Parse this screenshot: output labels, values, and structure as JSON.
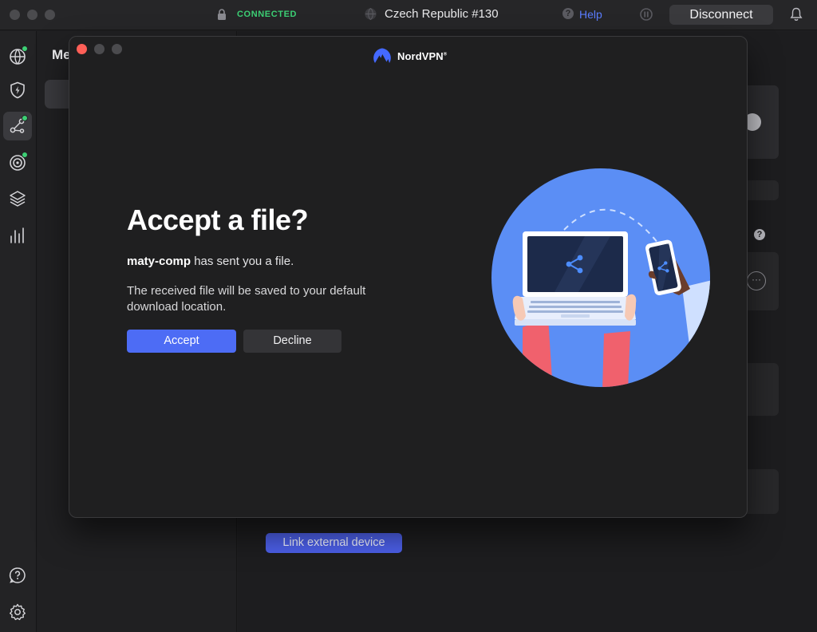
{
  "titlebar": {
    "status": "CONNECTED",
    "server": "Czech Republic #130",
    "help_label": "Help",
    "disconnect_label": "Disconnect"
  },
  "sidebar": {
    "items": [
      {
        "icon": "globe-icon",
        "status_dot": true
      },
      {
        "icon": "shield-bolt-icon",
        "status_dot": false
      },
      {
        "icon": "meshnet-icon",
        "status_dot": true,
        "active": true
      },
      {
        "icon": "target-icon",
        "status_dot": true
      },
      {
        "icon": "layers-icon",
        "status_dot": false
      },
      {
        "icon": "stats-icon",
        "status_dot": false
      }
    ],
    "bottom_items": [
      {
        "icon": "help-icon"
      },
      {
        "icon": "settings-gear-icon"
      }
    ]
  },
  "panel": {
    "title": "Me"
  },
  "main": {
    "link_button_label": "Link external device"
  },
  "modal": {
    "brand": "NordVPN",
    "brand_mark": "®",
    "title": "Accept a file?",
    "sender_name": "maty-comp",
    "sender_suffix": " has sent you a file.",
    "info": "The received file will be saved to your default download location.",
    "accept_label": "Accept",
    "decline_label": "Decline"
  },
  "colors": {
    "accent": "#4d6cf5",
    "connected": "#3ccf74",
    "close_light": "#ff5f57",
    "illustration_bg": "#5b8ef5"
  }
}
